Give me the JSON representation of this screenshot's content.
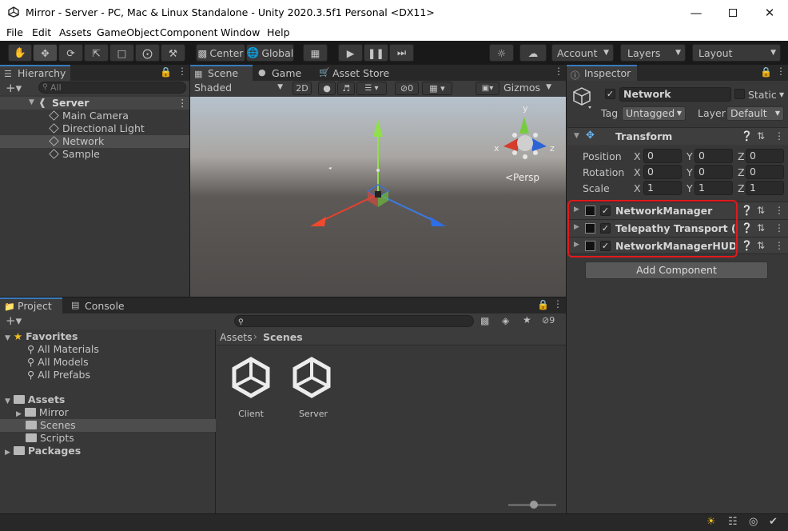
{
  "window": {
    "title": "Mirror - Server - PC, Mac & Linux Standalone - Unity 2020.3.5f1 Personal <DX11>"
  },
  "menu": [
    "File",
    "Edit",
    "Assets",
    "GameObject",
    "Component",
    "Window",
    "Help"
  ],
  "toolbar": {
    "center": "Center",
    "global": "Global",
    "account": "Account",
    "layers": "Layers",
    "layout": "Layout"
  },
  "hierarchy": {
    "tab": "Hierarchy",
    "search_placeholder": "All",
    "scene": "Server",
    "items": [
      "Main Camera",
      "Directional Light",
      "Network",
      "Sample"
    ]
  },
  "scene_view": {
    "tabs": [
      "Scene",
      "Game",
      "Asset Store"
    ],
    "shading": "Shaded",
    "mode_2d": "2D",
    "hidden_count": "0",
    "gizmos": "Gizmos",
    "persp": "<Persp",
    "axis_labels": {
      "x": "x",
      "y": "y",
      "z": "z"
    }
  },
  "project": {
    "tabs": [
      "Project",
      "Console"
    ],
    "hidden_count": "9",
    "favorites": {
      "label": "Favorites",
      "items": [
        "All Materials",
        "All Models",
        "All Prefabs"
      ]
    },
    "assets": {
      "label": "Assets",
      "items": [
        "Mirror",
        "Scenes",
        "Scripts"
      ]
    },
    "packages": "Packages",
    "breadcrumb": [
      "Assets",
      "Scenes"
    ],
    "files": [
      "Client",
      "Server"
    ]
  },
  "inspector": {
    "tab": "Inspector",
    "object_name": "Network",
    "static_label": "Static",
    "tag_label": "Tag",
    "tag_value": "Untagged",
    "layer_label": "Layer",
    "layer_value": "Default",
    "transform": {
      "title": "Transform",
      "rows": [
        {
          "label": "Position",
          "x": "0",
          "y": "0",
          "z": "0"
        },
        {
          "label": "Rotation",
          "x": "0",
          "y": "0",
          "z": "0"
        },
        {
          "label": "Scale",
          "x": "1",
          "y": "1",
          "z": "1"
        }
      ],
      "axis": {
        "x": "X",
        "y": "Y",
        "z": "Z"
      }
    },
    "components": [
      "NetworkManager",
      "Telepathy Transport (Script)",
      "NetworkManagerHUD"
    ],
    "add_component": "Add Component",
    "highlight_color": "#e0191c"
  }
}
